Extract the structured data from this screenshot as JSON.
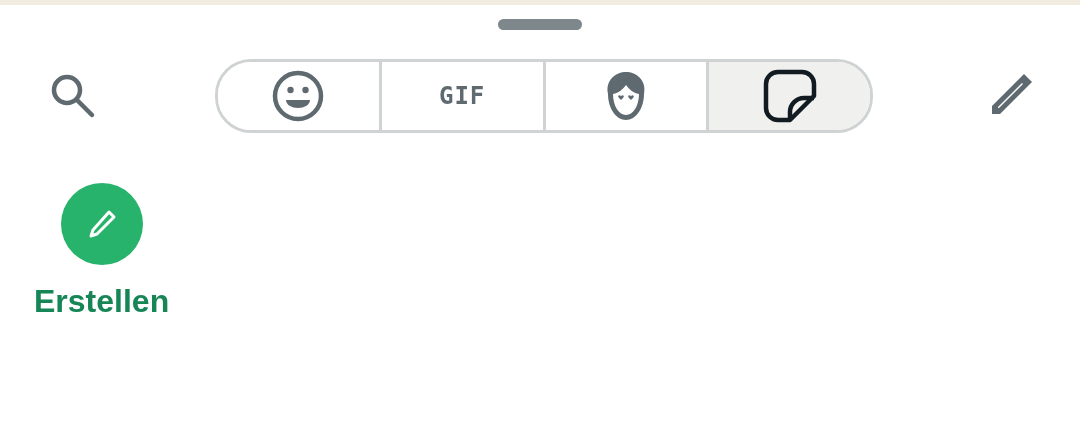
{
  "tabs": [
    {
      "kind": "emoji",
      "selected": false
    },
    {
      "kind": "gif",
      "label": "GIF",
      "selected": false
    },
    {
      "kind": "avatar",
      "selected": false
    },
    {
      "kind": "sticker",
      "selected": true
    }
  ],
  "create_button": {
    "label": "Erstellen"
  }
}
